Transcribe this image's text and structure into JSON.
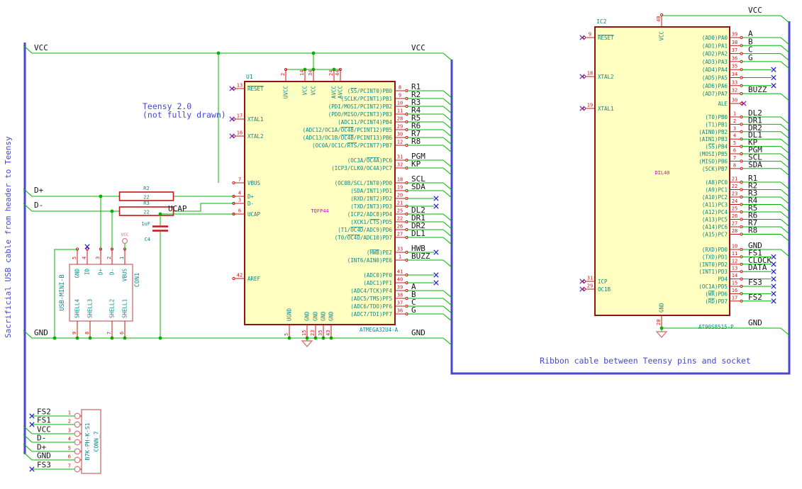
{
  "notes": {
    "usb_cable": "Sacrificial USB cable from header to Teensy",
    "teensy_1": "Teensy 2.0",
    "teensy_2": "(not fully drawn)",
    "ribbon": "Ribbon cable between Teensy pins and socket"
  },
  "net_labels": {
    "vcc": "VCC",
    "gnd": "GND",
    "d_plus": "D+",
    "d_minus": "D-",
    "ucap": "UCAP"
  },
  "colors": {
    "wire": "#00b400",
    "bus": "#4747d2",
    "nc": "#2525cc",
    "pin": "#c41717",
    "outline": "#941414",
    "body_fill": "#ffffc2",
    "pin_name": "#0d8686",
    "field": "#0d8686",
    "package_text": "#c40fc4",
    "label": "#161616",
    "symbol": "#d08080",
    "note": "#4747d2"
  },
  "components": {
    "u1": {
      "ref": "U1",
      "value": "ATMEGA32U4-A",
      "package": "TQFP44",
      "left_pins": [
        {
          "n": "13",
          "name": "~RESET~",
          "nc": true
        },
        {
          "n": "17",
          "name": "XTAL1",
          "nc": true
        },
        {
          "n": "16",
          "name": "XTAL2",
          "nc": true
        },
        {
          "n": "7",
          "name": "VBUS"
        },
        {
          "n": "4",
          "name": "D+"
        },
        {
          "n": "3",
          "name": "D-"
        },
        {
          "n": "6",
          "name": "UCAP"
        },
        {
          "n": "42",
          "name": "AREF"
        }
      ],
      "top_pins": [
        {
          "n": "2",
          "name": "UVCC"
        },
        {
          "n": "14",
          "name": "VCC"
        },
        {
          "n": "34",
          "name": "VCC"
        },
        {
          "n": "24",
          "name": "AVCC"
        },
        {
          "n": "44",
          "name": "AVCC"
        }
      ],
      "bottom_pins": [
        {
          "n": "5",
          "name": "UGND"
        },
        {
          "n": "15",
          "name": "GND"
        },
        {
          "n": "23",
          "name": "GND"
        },
        {
          "n": "35",
          "name": "GND"
        },
        {
          "n": "43",
          "name": "GND"
        }
      ],
      "right_pins": [
        {
          "n": "8",
          "name": "(~SS~/PCINT0)PB0",
          "label": "R1"
        },
        {
          "n": "9",
          "name": "(SCLK/PCINT1)PB1",
          "label": "R2"
        },
        {
          "n": "10",
          "name": "(PDI/MOSI/PCINT2)PB2",
          "label": "R3"
        },
        {
          "n": "11",
          "name": "(PDO/MISO/PCINT3)PB3",
          "label": "R4"
        },
        {
          "n": "28",
          "name": "(ADC11/PCINT4)PB4",
          "label": "R5"
        },
        {
          "n": "29",
          "name": "(ADC12/OC1A/~OC4B~/PCINT12)PB5",
          "label": "R6"
        },
        {
          "n": "30",
          "name": "(ADC13/OC1B/~OC4B~/PCINT13)PB6",
          "label": "R7"
        },
        {
          "n": "12",
          "name": "(OC0A/OC1C/~RTS~/PCINT7)PB7",
          "label": "R8"
        },
        {
          "n": "31",
          "name": "(OC3A/~OC4A~)PC6",
          "label": "PGM"
        },
        {
          "n": "32",
          "name": "(ICP3/CLK0/OC4A)PC7",
          "label": "KP"
        },
        {
          "n": "18",
          "name": "(OC0B/SCL/INT0)PD0",
          "label": "SCL"
        },
        {
          "n": "19",
          "name": "(SDA/INT1)PD1",
          "label": "SDA"
        },
        {
          "n": "20",
          "name": "(RXD/INT2)PD2",
          "nc": true
        },
        {
          "n": "21",
          "name": "(TXD/INT3)PD3",
          "nc": true
        },
        {
          "n": "25",
          "name": "(ICP2/ADC8)PD4",
          "label": "DL2"
        },
        {
          "n": "22",
          "name": "(XCK1/~CTS~)PD5",
          "label": "DR1"
        },
        {
          "n": "26",
          "name": "(T1/~OC4D~/ADC9)PD6",
          "label": "DR2"
        },
        {
          "n": "27",
          "name": "(T0/~OC4D~/ADC10)PD7",
          "label": "DL1"
        },
        {
          "n": "33",
          "name": "(~HWB~)PE2",
          "label": "HWB",
          "nc": true
        },
        {
          "n": "1",
          "name": "(INT6/AIN0)PE6",
          "label": "BUZZ"
        },
        {
          "n": "41",
          "name": "(ADC0)PF0",
          "nc": true
        },
        {
          "n": "40",
          "name": "(ADC1)PF1",
          "nc": true
        },
        {
          "n": "39",
          "name": "(ADC4/TCK)PF4",
          "label": "A"
        },
        {
          "n": "38",
          "name": "(ADC5/TMS)PF5",
          "label": "B"
        },
        {
          "n": "37",
          "name": "(ADC6/TDO)PF6",
          "label": "C"
        },
        {
          "n": "36",
          "name": "(ADC7/TDI)PF7",
          "label": "G"
        }
      ]
    },
    "ic2": {
      "ref": "IC2",
      "value": "AT90S8515-P",
      "package": "DIL40",
      "left_pins": [
        {
          "n": "9",
          "name": "~RESET~",
          "nc": true
        },
        {
          "n": "18",
          "name": "XTAL2",
          "nc": true
        },
        {
          "n": "19",
          "name": "XTAL1",
          "nc": true
        },
        {
          "n": "31",
          "name": "ICP",
          "nc": true
        },
        {
          "n": "29",
          "name": "OC1B",
          "nc": true
        }
      ],
      "top_pins": [
        {
          "n": "40",
          "name": "VCC"
        }
      ],
      "bottom_pins": [
        {
          "n": "20",
          "name": "GND"
        }
      ],
      "right_pins": [
        {
          "n": "39",
          "name": "(AD0)PA0",
          "label": "A"
        },
        {
          "n": "38",
          "name": "(AD1)PA1",
          "label": "B"
        },
        {
          "n": "37",
          "name": "(AD2)PA2",
          "label": "C"
        },
        {
          "n": "36",
          "name": "(AD3)PA3",
          "label": "G"
        },
        {
          "n": "35",
          "name": "(AD4)PA4",
          "nc": true
        },
        {
          "n": "34",
          "name": "(AD5)PA5",
          "nc": true
        },
        {
          "n": "33",
          "name": "(AD6)PA6",
          "nc": true
        },
        {
          "n": "32",
          "name": "(AD7)PA7",
          "label": "BUZZ"
        },
        {
          "n": "30",
          "name": "ALE",
          "nc": true,
          "nc_at_pin": true
        },
        {
          "n": "1",
          "name": "(T0)PB0",
          "label": "DL2"
        },
        {
          "n": "2",
          "name": "(T1)PB1",
          "label": "DR1"
        },
        {
          "n": "3",
          "name": "(AIN0)PB2",
          "label": "DR2"
        },
        {
          "n": "4",
          "name": "(AIN1)PB3",
          "label": "DL1"
        },
        {
          "n": "5",
          "name": "(~SS~)PB4",
          "label": "KP"
        },
        {
          "n": "6",
          "name": "(MOSI)PB5",
          "label": "PGM"
        },
        {
          "n": "7",
          "name": "(MISO)PB6",
          "label": "SCL"
        },
        {
          "n": "8",
          "name": "(SCK)PB7",
          "label": "SDA"
        },
        {
          "n": "21",
          "name": "(A8)PC0",
          "label": "R1"
        },
        {
          "n": "22",
          "name": "(A9)PC1",
          "label": "R2"
        },
        {
          "n": "23",
          "name": "(A10)PC2",
          "label": "R3"
        },
        {
          "n": "24",
          "name": "(A11)PC3",
          "label": "R4"
        },
        {
          "n": "25",
          "name": "(A12)PC4",
          "label": "R5"
        },
        {
          "n": "26",
          "name": "(A13)PC5",
          "label": "R6"
        },
        {
          "n": "27",
          "name": "(A14)PC6",
          "label": "R7"
        },
        {
          "n": "28",
          "name": "(A15)PC7",
          "label": "R8"
        },
        {
          "n": "10",
          "name": "(RXD)PD0",
          "label": "GND"
        },
        {
          "n": "11",
          "name": "(TXD)PD1",
          "label": "FS1",
          "nc": true
        },
        {
          "n": "12",
          "name": "(INT0)PD2",
          "label": "CLOCK",
          "nc": true
        },
        {
          "n": "13",
          "name": "(INT1)PD3",
          "label": "DATA",
          "nc": true
        },
        {
          "n": "14",
          "name": "PD4",
          "nc": true
        },
        {
          "n": "15",
          "name": "(OC1A)PD5",
          "label": "FS3",
          "nc": true
        },
        {
          "n": "16",
          "name": "(~WR~)PD6",
          "nc": true
        },
        {
          "n": "17",
          "name": "(~RD~)PD7",
          "label": "FS2",
          "nc": true
        }
      ]
    },
    "con1": {
      "ref": "CON1",
      "value": "USB-MINI-B",
      "top_pins": [
        {
          "n": "5",
          "name": "GND"
        },
        {
          "n": "4",
          "name": "ID",
          "nc": true
        },
        {
          "n": "3",
          "name": "D+"
        },
        {
          "n": "2",
          "name": "D-"
        },
        {
          "n": "1",
          "name": "VBUS",
          "power": "VCC"
        }
      ],
      "bottom_pins": [
        {
          "n": "9",
          "name": "SHELL4"
        },
        {
          "n": "8",
          "name": "SHELL3"
        },
        {
          "n": "7",
          "name": "SHELL2"
        },
        {
          "n": "6",
          "name": "SHELL1"
        }
      ]
    },
    "conn7": {
      "ref": "CONN_7",
      "value": "B7K-PH-K-S1",
      "pins": [
        {
          "n": "1",
          "label": "FS2",
          "nc": true
        },
        {
          "n": "2",
          "label": "FS1",
          "nc": true
        },
        {
          "n": "3",
          "label": "VCC"
        },
        {
          "n": "4",
          "label": "D-"
        },
        {
          "n": "5",
          "label": "D+"
        },
        {
          "n": "6",
          "label": "GND"
        },
        {
          "n": "7",
          "label": "FS3",
          "nc": true
        }
      ]
    },
    "r2": {
      "ref": "R2",
      "value": "22"
    },
    "r3": {
      "ref": "R3",
      "value": "22"
    },
    "c4": {
      "ref": "C4",
      "value": "1uF"
    }
  }
}
